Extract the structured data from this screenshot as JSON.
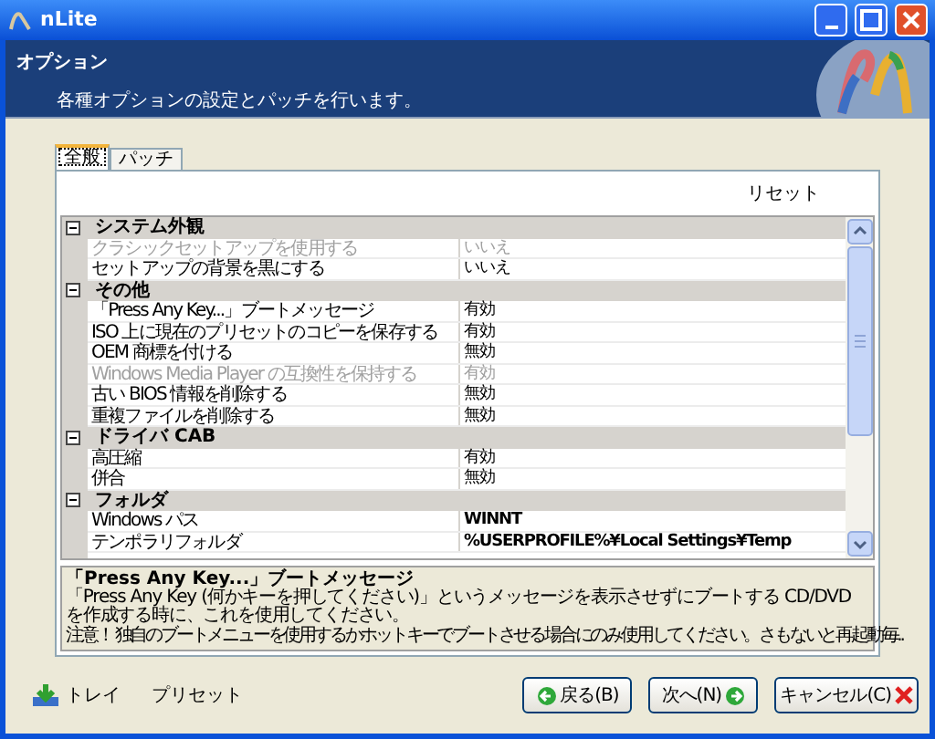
{
  "window": {
    "title": "nLite"
  },
  "header": {
    "title": "オプション",
    "subtitle": "各種オプションの設定とパッチを行います。"
  },
  "tabs": [
    {
      "label": "全般",
      "selected": true
    },
    {
      "label": "パッチ",
      "selected": false
    }
  ],
  "reset_link": "リセット",
  "categories": [
    {
      "name": "システム外観",
      "expanded": true,
      "items": [
        {
          "name": "クラシックセットアップを使用する",
          "value": "いいえ",
          "disabled": true,
          "modified": false
        },
        {
          "name": "セットアップの背景を黒にする",
          "value": "いいえ",
          "disabled": false,
          "modified": false
        }
      ]
    },
    {
      "name": "その他",
      "expanded": true,
      "items": [
        {
          "name": "「Press Any Key...」ブートメッセージ",
          "value": "有効",
          "disabled": false,
          "modified": false
        },
        {
          "name": "ISO 上に現在のプリセットのコピーを保存する",
          "value": "有効",
          "disabled": false,
          "modified": false
        },
        {
          "name": "OEM 商標を付ける",
          "value": "無効",
          "disabled": false,
          "modified": false
        },
        {
          "name": "Windows Media Player の互換性を保持する",
          "value": "有効",
          "disabled": true,
          "modified": false
        },
        {
          "name": "古い BIOS 情報を削除する",
          "value": "無効",
          "disabled": false,
          "modified": false
        },
        {
          "name": "重複ファイルを削除する",
          "value": "無効",
          "disabled": false,
          "modified": false
        }
      ]
    },
    {
      "name": "ドライバ CAB",
      "expanded": true,
      "items": [
        {
          "name": "高圧縮",
          "value": "有効",
          "disabled": false,
          "modified": false
        },
        {
          "name": "併合",
          "value": "無効",
          "disabled": false,
          "modified": false
        }
      ]
    },
    {
      "name": "フォルダ",
      "expanded": true,
      "items": [
        {
          "name": "Windows パス",
          "value": "WINNT",
          "disabled": false,
          "modified": true
        },
        {
          "name": "テンポラリフォルダ",
          "value": "%USERPROFILE%¥Local Settings¥Temp",
          "disabled": false,
          "modified": true
        }
      ]
    }
  ],
  "description": {
    "title": "「Press Any Key...」ブートメッセージ",
    "text": "「Press Any Key (何かキーを押してください)」というメッセージを表示させずにブートする CD/DVD を作成する時に、これを使用してください。",
    "note": "注意！ 独自のブートメニューを使用するかホットキーでブートさせる場合にのみ使用してください。さもないと再起動毎.."
  },
  "footer_links": [
    {
      "label": "トレイ",
      "kind": "tray"
    },
    {
      "label": "プリセット",
      "kind": "plain"
    }
  ],
  "buttons": [
    {
      "label": "戻る(B)",
      "kind": "back"
    },
    {
      "label": "次へ(N)",
      "kind": "next"
    },
    {
      "label": "キャンセル(C)",
      "kind": "cancel"
    }
  ]
}
